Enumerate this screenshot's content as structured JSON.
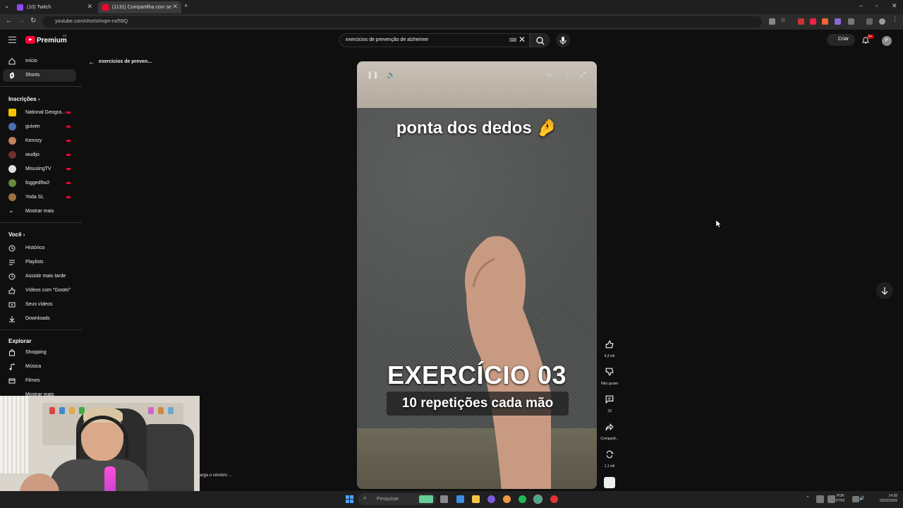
{
  "browser": {
    "tabs": [
      {
        "title": "(10) Twitch",
        "favicon_color": "#9146ff"
      },
      {
        "title": "(1131) Compartilha com se",
        "favicon_color": "#ff0033"
      }
    ],
    "url": "youtube.com/shorts/mqm-nxl58Q"
  },
  "header": {
    "logo_text": "Premium",
    "logo_sup": "BR",
    "search_query": "exercicios de prevenção de alzheimer",
    "create_label": "Criar",
    "notification_count": "9+",
    "avatar_letter": "P"
  },
  "sidebar": {
    "main": [
      {
        "label": "Início",
        "icon": "home-icon"
      },
      {
        "label": "Shorts",
        "icon": "shorts-icon",
        "active": true
      }
    ],
    "subscriptions_title": "Inscrições",
    "subscriptions": [
      {
        "label": "National Geogra...",
        "color": "#f5c400"
      },
      {
        "label": "guiven",
        "color": "#4a6fb3"
      },
      {
        "label": "Kennzy",
        "color": "#c08060"
      },
      {
        "label": "wudijo",
        "color": "#703030"
      },
      {
        "label": "MisusingTV",
        "color": "#e0e0e0"
      },
      {
        "label": "foggedftw2",
        "color": "#6a8a40"
      },
      {
        "label": "Yoda SL",
        "color": "#a07040"
      }
    ],
    "show_more": "Mostrar mais",
    "you_title": "Você",
    "you": [
      {
        "label": "Histórico",
        "icon": "history-icon"
      },
      {
        "label": "Playlists",
        "icon": "playlists-icon"
      },
      {
        "label": "Assistir mais tarde",
        "icon": "watch-later-icon"
      },
      {
        "label": "Vídeos com \"Gostei\"",
        "icon": "liked-videos-icon"
      },
      {
        "label": "Seus vídeos",
        "icon": "your-videos-icon"
      },
      {
        "label": "Downloads",
        "icon": "downloads-icon"
      }
    ],
    "explore_title": "Explorar",
    "explore": [
      {
        "label": "Shopping",
        "icon": "shopping-icon"
      },
      {
        "label": "Música",
        "icon": "music-icon"
      },
      {
        "label": "Filmes",
        "icon": "movies-icon"
      }
    ],
    "explore_more": "Mostrar mais"
  },
  "back_link": "exercicios de preven...",
  "video": {
    "top_text": "ponta dos dedos 🤌",
    "title_text": "EXERCÍCIO 03",
    "subtitle_text": "10 repetições cada mão"
  },
  "actions": {
    "likes": "4,3 mil",
    "dislike": "Não gostei",
    "comments": "33",
    "share": "Compartil...",
    "remix": "1,1 mil"
  },
  "webcam_caption": "arga o cérebro ...",
  "taskbar": {
    "search_placeholder": "Pesquisar",
    "lang_1": "POR",
    "lang_2": "PTB2",
    "time": "14:38",
    "date": "02/02/2026"
  }
}
